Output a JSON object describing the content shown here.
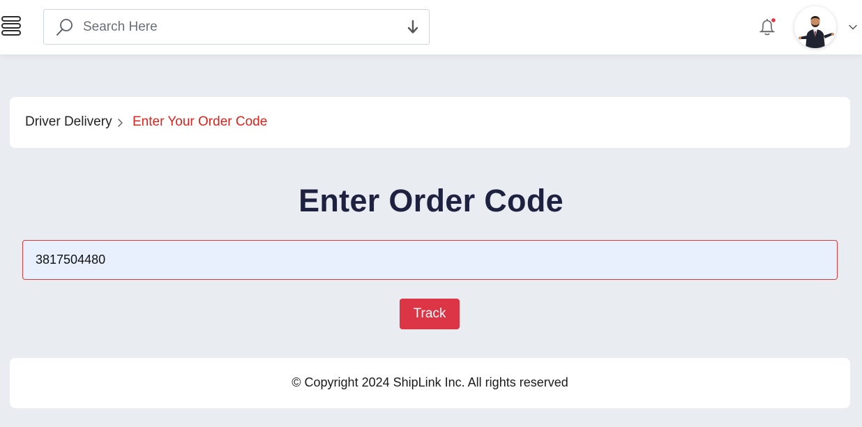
{
  "header": {
    "menu_icon": "hamburger-menu-icon",
    "search": {
      "placeholder": "Search Here",
      "value": "",
      "icon": "search-icon",
      "action_icon": "arrow-down-icon"
    },
    "notifications": {
      "icon": "bell-icon",
      "has_unread": true,
      "dot_color": "#e0334a"
    },
    "user": {
      "avatar_icon": "user-avatar",
      "dropdown_icon": "chevron-down-icon"
    }
  },
  "breadcrumb": {
    "home": "Driver Delivery",
    "separator_icon": "chevron-right-icon",
    "current": "Enter Your Order Code"
  },
  "main": {
    "title": "Enter Order Code",
    "order_input": {
      "value": "3817504480",
      "placeholder": ""
    },
    "track_label": "Track"
  },
  "footer": {
    "text": "© Copyright 2024 ShipLink Inc. All rights reserved"
  },
  "colors": {
    "accent": "#dc3545",
    "breadcrumb_active": "#d8241e",
    "title": "#1e2240",
    "background": "#e9ecf1",
    "input_bg": "#e8f0fe"
  }
}
